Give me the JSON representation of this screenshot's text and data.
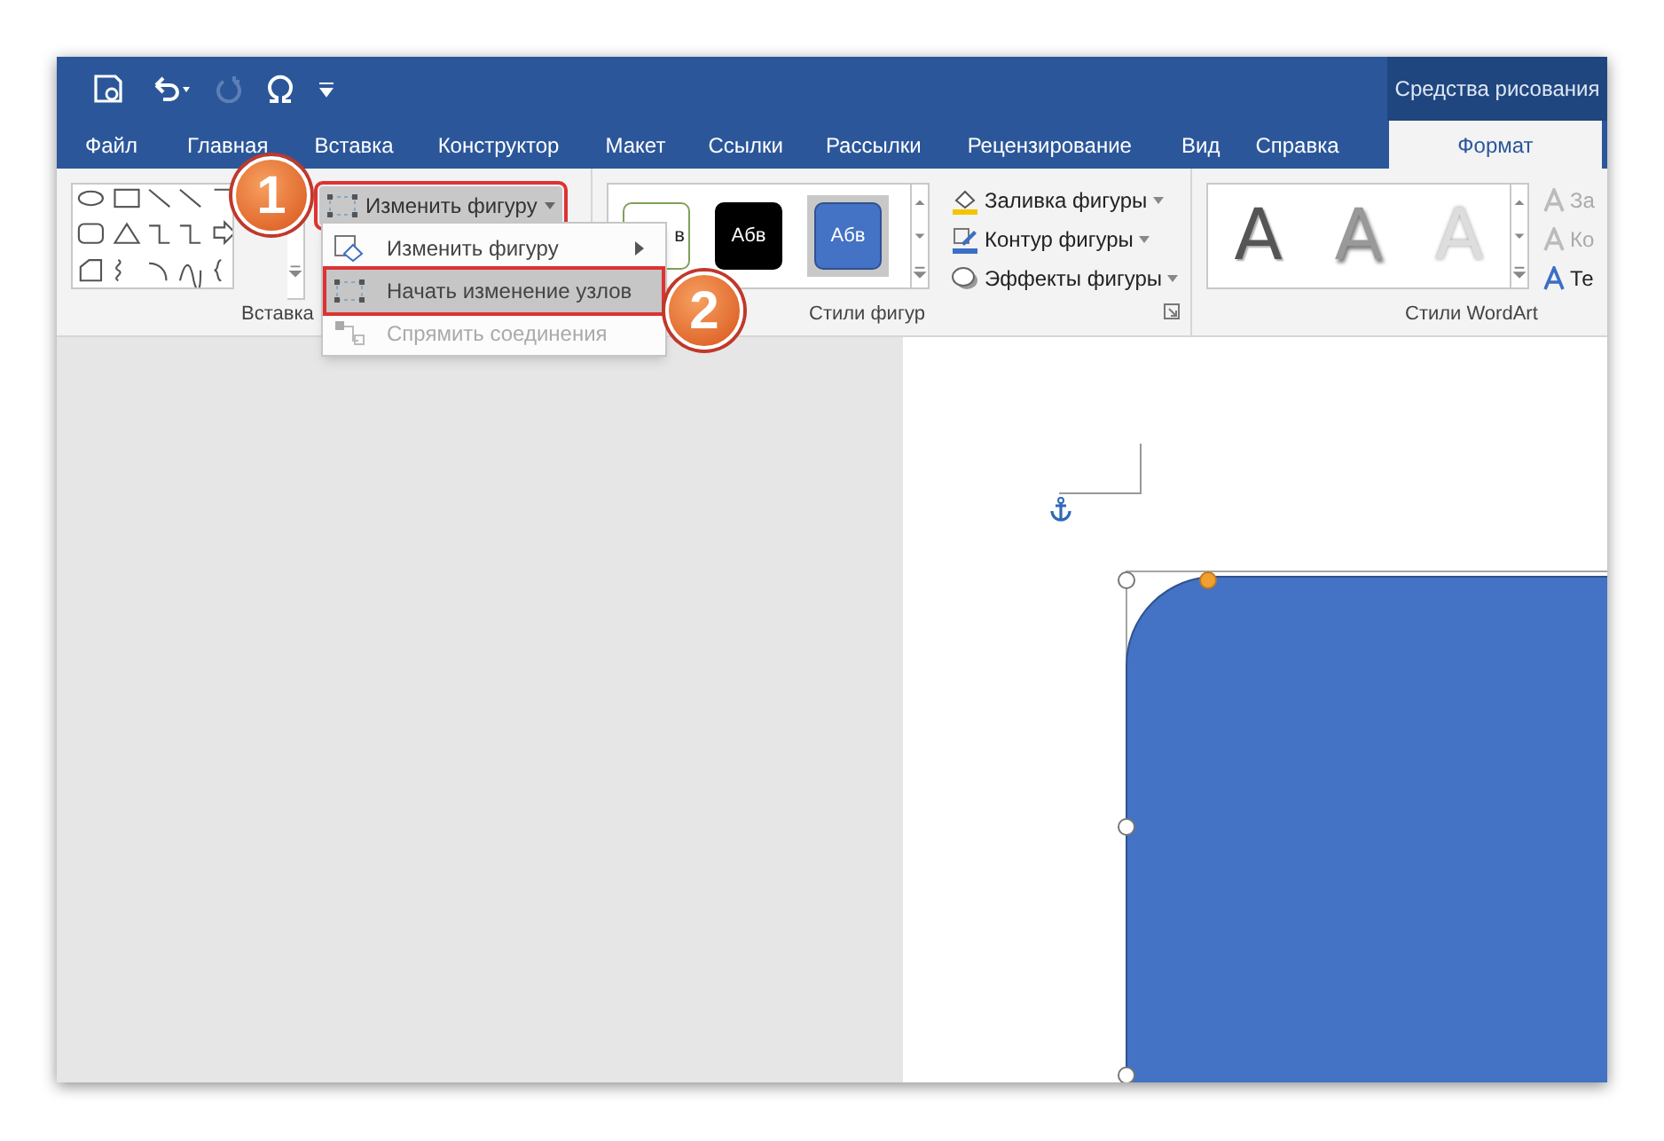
{
  "context_group": {
    "title": "Средства рисования"
  },
  "tabs": [
    {
      "label": "Файл",
      "selected": false
    },
    {
      "label": "Главная",
      "selected": false
    },
    {
      "label": "Вставка",
      "selected": false
    },
    {
      "label": "Конструктор",
      "selected": false
    },
    {
      "label": "Макет",
      "selected": false
    },
    {
      "label": "Ссылки",
      "selected": false
    },
    {
      "label": "Рассылки",
      "selected": false
    },
    {
      "label": "Рецензирование",
      "selected": false
    },
    {
      "label": "Вид",
      "selected": false
    },
    {
      "label": "Справка",
      "selected": false
    },
    {
      "label": "Формат",
      "selected": true
    }
  ],
  "insert_shapes": {
    "group_label": "Вставка",
    "edit_shape_button": "Изменить фигуру"
  },
  "shape_styles": {
    "group_label": "Стили фигур",
    "tiles": [
      {
        "text": "в",
        "kind": "outline",
        "selected": false
      },
      {
        "text": "Абв",
        "kind": "dark",
        "selected": false
      },
      {
        "text": "Абв",
        "kind": "blue",
        "selected": true
      }
    ],
    "commands": [
      {
        "label": "Заливка фигуры",
        "kind": "fill"
      },
      {
        "label": "Контур фигуры",
        "kind": "outline"
      },
      {
        "label": "Эффекты фигуры",
        "kind": "effects"
      }
    ]
  },
  "wordart_styles": {
    "group_label": "Стили WordArt",
    "samples": [
      {
        "text": "A",
        "kind": "solid"
      },
      {
        "text": "A",
        "kind": "shadow"
      },
      {
        "text": "A",
        "kind": "light"
      }
    ],
    "commands": [
      {
        "label": "За",
        "disabled": true
      },
      {
        "label": "Ко",
        "disabled": true
      },
      {
        "label": "Те",
        "disabled": false
      }
    ]
  },
  "dropdown_menu": [
    {
      "label": "Изменить фигуру",
      "kind": "submenu",
      "selected": false,
      "disabled": false
    },
    {
      "label": "Начать изменение узлов",
      "kind": "nodes",
      "selected": true,
      "disabled": false
    },
    {
      "label": "Спрямить соединения",
      "kind": "reroute",
      "selected": false,
      "disabled": true
    }
  ],
  "callouts": [
    "1",
    "2"
  ]
}
